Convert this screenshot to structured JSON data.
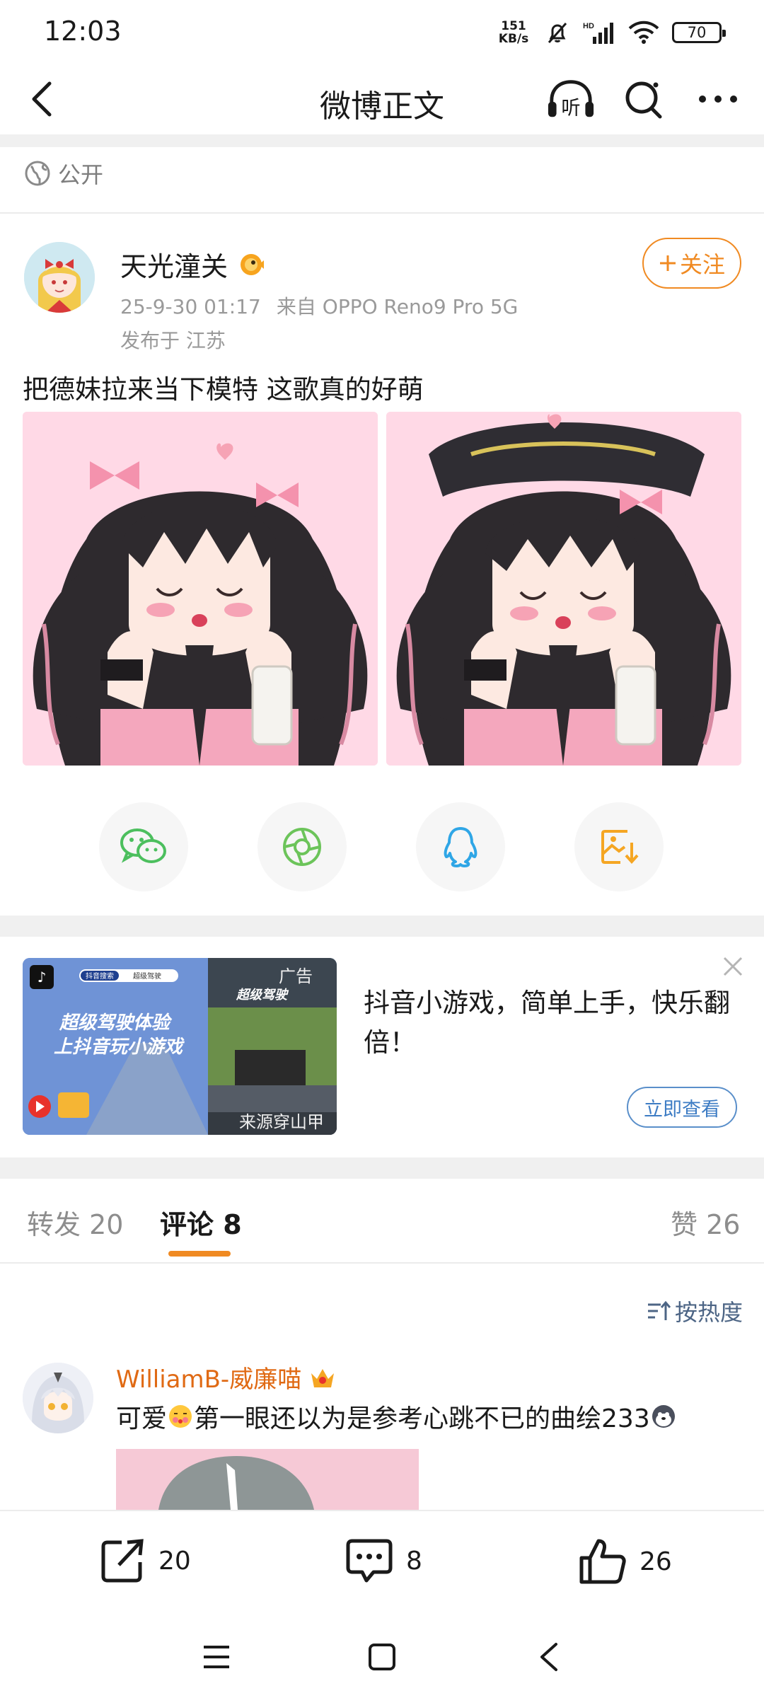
{
  "status_bar": {
    "time": "12:03",
    "net_speed_value": "151",
    "net_speed_unit": "KB/s",
    "battery": "70"
  },
  "header": {
    "title": "微博正文",
    "listen_label": "听"
  },
  "post": {
    "visibility": "公开",
    "author": "天光潼关",
    "time": "25-9-30 01:17",
    "source": "来自 OPPO Reno9 Pro 5G",
    "location": "发布于 江苏",
    "follow_label": "关注",
    "text": "把德妹拉来当下模特 这歌真的好萌"
  },
  "ad": {
    "badge": "广告",
    "image_caption_top": "超级驾驶体验",
    "image_caption_bottom": "上抖音玩小游戏",
    "search_label": "抖音搜索",
    "search_query": "超级驾驶",
    "game_title": "超级驾驶",
    "source": "来源穿山甲",
    "text": "抖音小游戏，简单上手，快乐翻倍！",
    "cta": "立即查看"
  },
  "tabs": [
    {
      "label": "转发",
      "count": "20"
    },
    {
      "label": "评论",
      "count": "8"
    },
    {
      "label": "赞",
      "count": "26"
    }
  ],
  "comments": {
    "sort_label": "按热度",
    "items": [
      {
        "user": "WilliamB-威廉喵",
        "text_a": "可爱",
        "text_b": "第一眼还以为是参考心跳不已的曲绘233"
      }
    ]
  },
  "bottom_bar": {
    "repost": "20",
    "comment": "8",
    "like": "26"
  },
  "colors": {
    "accent": "#f08a22",
    "link": "#4d6585",
    "ad_cta": "#3d7cc4",
    "wechat": "#4cbf5e",
    "moments": "#6cc45a",
    "qq": "#2fa6e6",
    "save": "#f5a623"
  }
}
